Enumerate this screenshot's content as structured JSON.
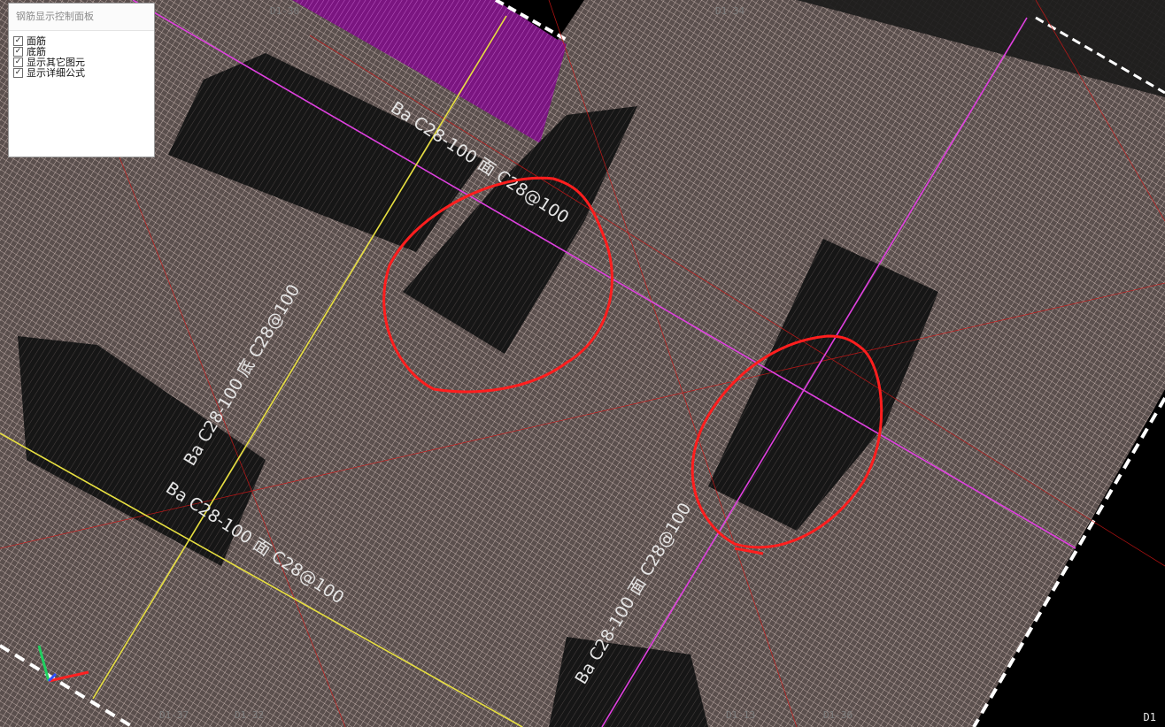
{
  "window_title": "钢筋显示控制面板",
  "options": [
    {
      "label": "面筋",
      "checked": true
    },
    {
      "label": "底筋",
      "checked": true
    },
    {
      "label": "显示其它图元",
      "checked": true
    },
    {
      "label": "显示详细公式",
      "checked": true
    }
  ],
  "rebar_labels": [
    "Ba C28-100 面 C28@100",
    "Ba C28-100 底 C28@100",
    "Ba C28-100 面 C28@100",
    "Ba C28-100 面 C28@100"
  ],
  "grid_labels": [
    "D1-34",
    "D1-30",
    "D1-37",
    "D1-32",
    "D1-13",
    "D1-36"
  ],
  "corner_label": "D1",
  "colors": {
    "background": "#000000",
    "mesh": "#c9b6b0",
    "axis_magenta": "#e040e0",
    "axis_yellow": "#e8e040",
    "annotation_red": "#ff1e1e",
    "block_magenta": "#9a1aa0"
  },
  "icons": {
    "check": "✓"
  }
}
